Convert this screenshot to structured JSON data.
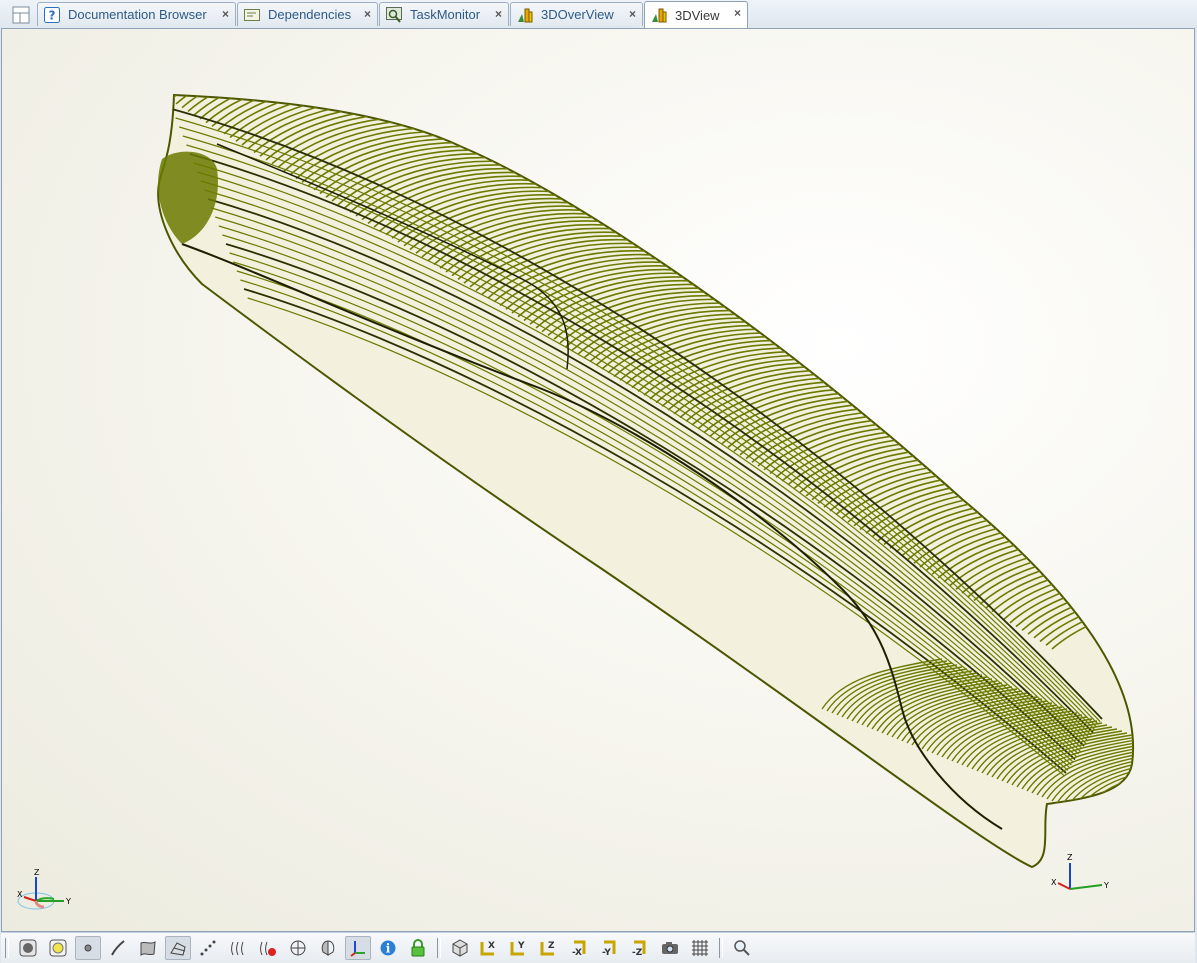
{
  "tabs": [
    {
      "label": "Documentation Browser",
      "icon": "help-icon",
      "close": "×"
    },
    {
      "label": "Dependencies",
      "icon": "dependencies-icon",
      "close": "×"
    },
    {
      "label": "TaskMonitor",
      "icon": "task-monitor-icon",
      "close": "×"
    },
    {
      "label": "3DOverView",
      "icon": "chart-icon",
      "close": "×"
    },
    {
      "label": "3DView",
      "icon": "chart-icon",
      "close": "×",
      "active": true
    }
  ],
  "viewport": {
    "description_icon": "ship-hull-wireframe",
    "hull_color": "#6b7a00",
    "background": "#f6f5ee"
  },
  "axes_left": {
    "x": "X",
    "y": "Y",
    "z": "Z"
  },
  "axes_right": {
    "x": "X",
    "y": "Y",
    "z": "Z"
  },
  "toolbar": {
    "items": [
      "shaded-icon",
      "highlight-icon",
      "point-icon",
      "curve-icon",
      "surface-icon",
      "wireframe-icon",
      "dots-icon",
      "sections-icon",
      "hide-icon",
      "cross-section-icon",
      "half-icon",
      "axis-icon",
      "info-icon",
      "lock-icon",
      "cube-icon",
      "view-x-icon",
      "view-y-icon",
      "view-z-icon",
      "view-minus-x-icon",
      "view-minus-y-icon",
      "view-minus-z-icon",
      "camera-icon",
      "grid-icon",
      "zoom-icon"
    ],
    "view_labels": {
      "x": "X",
      "y": "Y",
      "z": "Z",
      "mx": "-X",
      "my": "-Y",
      "mz": "-Z"
    }
  }
}
